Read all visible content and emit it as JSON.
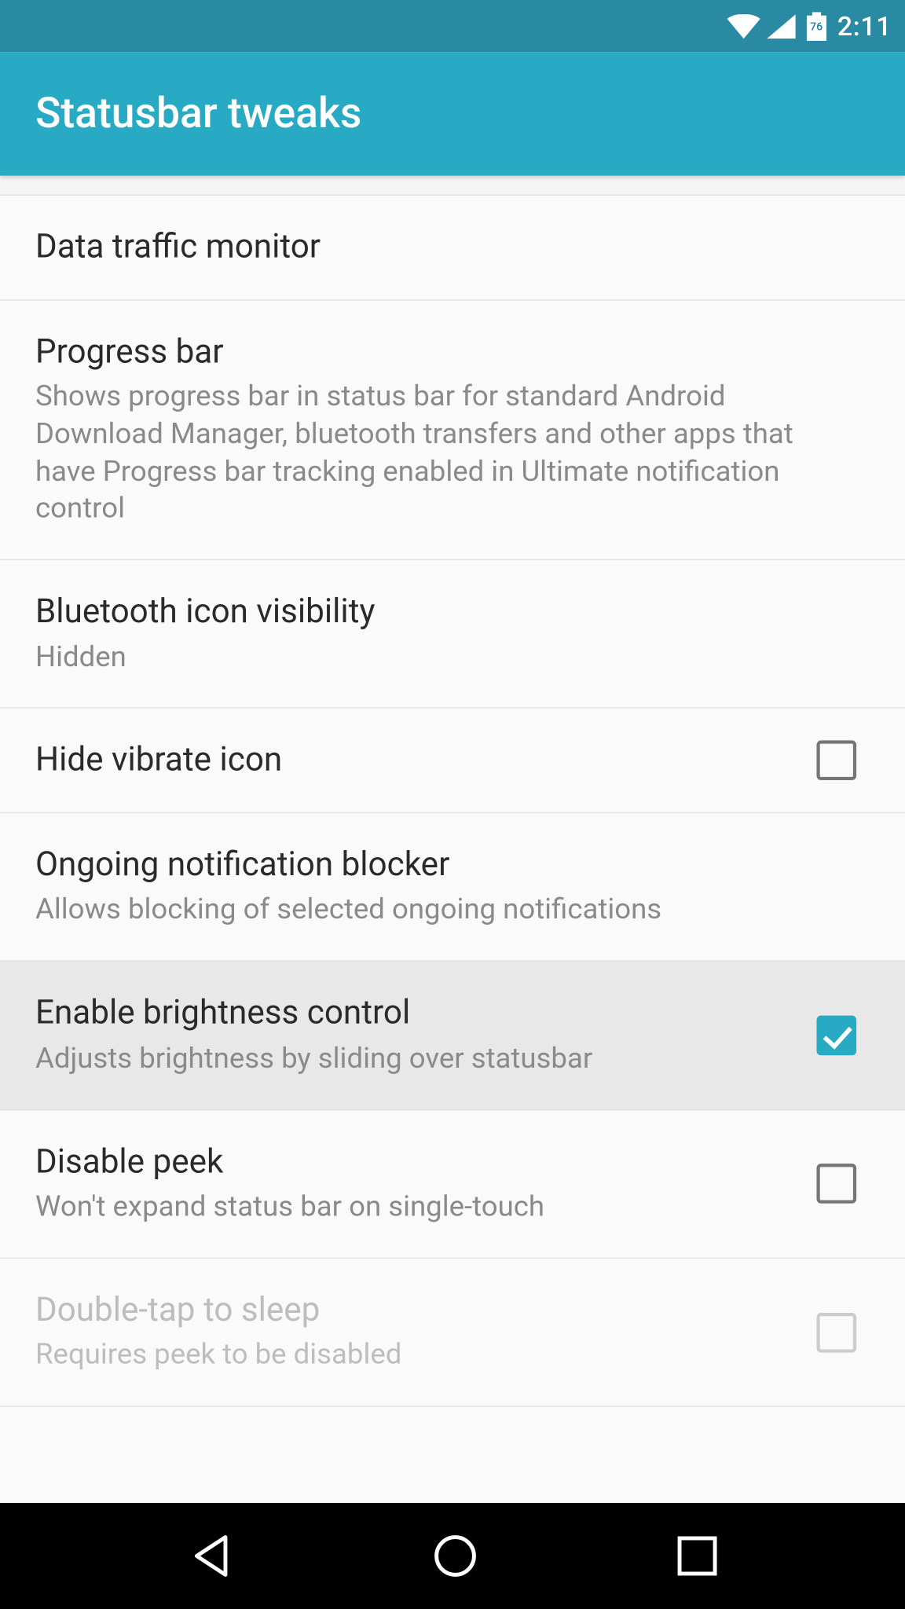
{
  "statusbar": {
    "battery_percent": "76",
    "time": "2:11"
  },
  "appbar": {
    "title": "Statusbar tweaks"
  },
  "prefs": {
    "data_traffic": {
      "title": "Data traffic monitor"
    },
    "progress_bar": {
      "title": "Progress bar",
      "summary": "Shows progress bar in status bar for standard Android Download Manager, bluetooth transfers and other apps that have Progress bar tracking enabled in Ultimate notification control"
    },
    "bt_icon": {
      "title": "Bluetooth icon visibility",
      "summary": "Hidden"
    },
    "hide_vibrate": {
      "title": "Hide vibrate icon"
    },
    "ongoing_blocker": {
      "title": "Ongoing notification blocker",
      "summary": "Allows blocking of selected ongoing notifications"
    },
    "brightness": {
      "title": "Enable brightness control",
      "summary": "Adjusts brightness by sliding over statusbar"
    },
    "disable_peek": {
      "title": "Disable peek",
      "summary": "Won't expand status bar on single-touch"
    },
    "double_tap": {
      "title": "Double-tap to sleep",
      "summary": "Requires peek to be disabled"
    }
  }
}
